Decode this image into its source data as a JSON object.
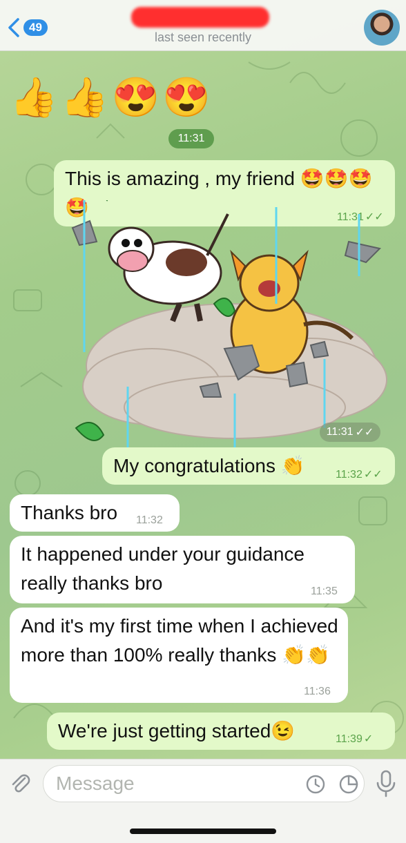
{
  "header": {
    "back_count": "49",
    "status": "last seen recently"
  },
  "emoji_row": "👍👍😍😍",
  "date_time_pill": "11:31",
  "messages": [
    {
      "dir": "out",
      "text": "This is amazing , my friend 🤩🤩🤩🤩",
      "time": "11:31"
    },
    {
      "dir": "sticker",
      "time": "11:31"
    },
    {
      "dir": "out",
      "text": "My congratulations 👏",
      "time": "11:32"
    },
    {
      "dir": "in",
      "text": "Thanks bro",
      "time": "11:32"
    },
    {
      "dir": "in",
      "text": "It happened under your guidance really thanks bro",
      "time": "11:35"
    },
    {
      "dir": "in",
      "text": "And it's my first time when I achieved more than 100%  really thanks 👏👏",
      "time": "11:36"
    },
    {
      "dir": "out",
      "text": "We're just getting started😉",
      "time": "11:39"
    }
  ],
  "composer": {
    "placeholder": "Message"
  },
  "icons": {
    "back": "chevron-left-icon",
    "attach": "paperclip-icon",
    "schedule": "clock-icon",
    "sticker": "sticker-icon",
    "mic": "microphone-icon"
  },
  "colors": {
    "outgoing_bubble": "#e3f9c9",
    "incoming_bubble": "#ffffff",
    "accent": "#2f8fe6",
    "check": "#5aa34a"
  }
}
